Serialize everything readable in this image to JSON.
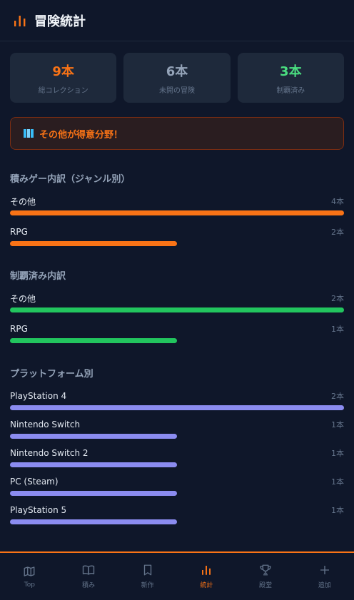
{
  "header": {
    "title": "冒険統計",
    "icon": "bar-chart-icon"
  },
  "stats": [
    {
      "value": "9本",
      "label": "総コレクション",
      "color": "#f97316"
    },
    {
      "value": "6本",
      "label": "未開の冒険",
      "color": "#94a3b8"
    },
    {
      "value": "3本",
      "label": "制覇済み",
      "color": "#4ade80"
    }
  ],
  "banner": {
    "text": "その他が得意分野！",
    "icon": "map-icon"
  },
  "sections": [
    {
      "title": "積みゲー内訳（ジャンル別）",
      "color": "#f97316",
      "rows": [
        {
          "name": "その他",
          "count": "4本",
          "fraction": 1.0
        },
        {
          "name": "RPG",
          "count": "2本",
          "fraction": 0.5
        }
      ]
    },
    {
      "title": "制覇済み内訳",
      "color": "#22c55e",
      "rows": [
        {
          "name": "その他",
          "count": "2本",
          "fraction": 1.0
        },
        {
          "name": "RPG",
          "count": "1本",
          "fraction": 0.5
        }
      ]
    },
    {
      "title": "プラットフォーム別",
      "color": "#8b8cf0",
      "rows": [
        {
          "name": "PlayStation 4",
          "count": "2本",
          "fraction": 1.0
        },
        {
          "name": "Nintendo Switch",
          "count": "1本",
          "fraction": 0.5
        },
        {
          "name": "Nintendo Switch 2",
          "count": "1本",
          "fraction": 0.5
        },
        {
          "name": "PC (Steam)",
          "count": "1本",
          "fraction": 0.5
        },
        {
          "name": "PlayStation 5",
          "count": "1本",
          "fraction": 0.5
        }
      ]
    }
  ],
  "nav": [
    {
      "label": "Top",
      "icon": "map-icon",
      "active": false
    },
    {
      "label": "積み",
      "icon": "book-icon",
      "active": false
    },
    {
      "label": "新作",
      "icon": "bookmark-icon",
      "active": false
    },
    {
      "label": "統計",
      "icon": "bar-chart-icon",
      "active": true
    },
    {
      "label": "殿堂",
      "icon": "trophy-icon",
      "active": false
    },
    {
      "label": "追加",
      "icon": "plus-icon",
      "active": false
    }
  ]
}
